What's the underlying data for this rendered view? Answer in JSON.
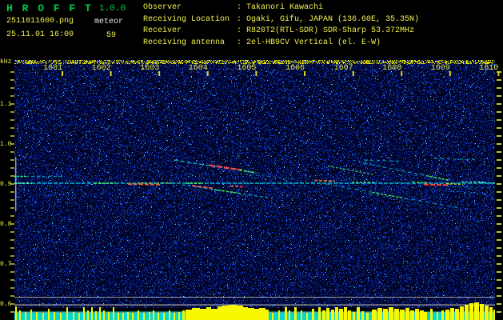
{
  "header": {
    "title": "H R O F F T",
    "version": "1.0.0",
    "filename": "2511011600.png",
    "mode": "meteor",
    "datetime": "25.11.01 16:00",
    "count": "59",
    "info": [
      {
        "label": "Observer",
        "value": "Takanori Kawachi"
      },
      {
        "label": "Receiving Location",
        "value": "Ogaki, Gifu, JAPAN (136.60E, 35.35N)"
      },
      {
        "label": "Receiver",
        "value": "R820T2(RTL-SDR) SDR-Sharp 53.372MHz"
      },
      {
        "label": "Receiving antenna",
        "value": "2el-HB9CV Vertical (el. E-W)"
      }
    ]
  },
  "spectrogram": {
    "unit_label": "kHz",
    "freq_labels": [
      "1.1",
      "1.0",
      "0.9",
      "0.8",
      "0.7",
      "0.6"
    ],
    "time_labels": [
      "1601",
      "1602",
      "1603",
      "1604",
      "1605",
      "1606",
      "1607",
      "1608",
      "1609",
      "1610"
    ],
    "colors": {
      "title_green": "#00cc44",
      "text_yellow": "#f0f050",
      "text_white": "#e8e8e8",
      "tick_yellow": "#d8d830",
      "trail_cyan": "#00c8d8",
      "hot_red": "#ff4444",
      "hot_green": "#55ee55",
      "signal_bar": "#f8f800",
      "signal_band": "#00d8d8",
      "grid_gray": "#a0a0a0"
    },
    "noise": {
      "seed": 987654321
    },
    "gray_lines": [
      [
        18,
        371.0,
        601,
        1.0,
        "#999999"
      ],
      [
        18,
        380.5,
        601,
        1.2,
        "#aaaaaa"
      ]
    ],
    "gray_line_low": [
      18,
      390.0,
      601,
      1.0,
      "#888888"
    ],
    "vertical_line": [
      19,
      196,
      1.4,
      68,
      "#cccccc"
    ],
    "trails": [
      [
        18,
        229,
        619,
        229,
        "#00c8d8",
        1.5,
        "5 2",
        0.9
      ],
      [
        18,
        220.5,
        80,
        220.5,
        "#00b0c0",
        1.3,
        "4 3",
        0.8
      ],
      [
        18,
        220.5,
        34,
        220.5,
        "#55ee55",
        1.8,
        "2 2",
        0.9
      ],
      [
        18,
        229,
        40,
        229,
        "#66ffcc",
        1.8,
        "3 2",
        0.85
      ],
      [
        118,
        229,
        144,
        229,
        "#55ee55",
        1.8,
        "3 2",
        0.9
      ],
      [
        160,
        230,
        202,
        230.8,
        "#ff6633",
        2.0,
        "5 2",
        0.9
      ],
      [
        172,
        228.5,
        214,
        229,
        "#aaee44",
        1.3,
        "2 3",
        0.85
      ],
      [
        233,
        229,
        254,
        229,
        "#55ee55",
        1.8,
        "3 2",
        0.9
      ],
      [
        218,
        200,
        322,
        216.5,
        "#00c8d8",
        1.4,
        "5 3",
        0.85
      ],
      [
        262,
        206.5,
        302,
        212.5,
        "#ff4444",
        2.4,
        "7 2",
        0.95
      ],
      [
        300,
        212.5,
        320,
        216,
        "#55ee55",
        1.8,
        "3 2",
        0.9
      ],
      [
        228,
        231,
        335,
        247,
        "#00c0d0",
        1.3,
        "4 3",
        0.8
      ],
      [
        240,
        232,
        268,
        235.5,
        "#ff5544",
        2.0,
        "5 2",
        0.9
      ],
      [
        268,
        237,
        302,
        242,
        "#55ee55",
        1.6,
        "3 2",
        0.85
      ],
      [
        288,
        232.5,
        306,
        233.5,
        "#ff5544",
        1.8,
        "4 2",
        0.85
      ],
      [
        300,
        217,
        368,
        223.5,
        "#00a8b8",
        1.1,
        "3 4",
        0.6
      ],
      [
        350,
        194.5,
        398,
        196,
        "#0098a8",
        1.0,
        "2 5",
        0.5
      ],
      [
        393,
        225.5,
        419,
        226.5,
        "#ff7733",
        1.8,
        "4 2",
        0.85
      ],
      [
        410,
        207.5,
        466,
        218,
        "#44dd77",
        1.4,
        "3 2",
        0.8
      ],
      [
        455,
        200,
        500,
        201.5,
        "#00c8d8",
        1.2,
        "4 4",
        0.75
      ],
      [
        543,
        198,
        594,
        199.5,
        "#00c8d8",
        1.2,
        "4 4",
        0.75
      ],
      [
        455,
        204,
        565,
        226,
        "#00b8c8",
        1.2,
        "5 3",
        0.7
      ],
      [
        533,
        219.5,
        560,
        225,
        "#55ee55",
        1.6,
        "3 2",
        0.85
      ],
      [
        516,
        227.5,
        534,
        228.5,
        "#55ee55",
        1.6,
        "3 2",
        0.85
      ],
      [
        530,
        230.5,
        562,
        231.5,
        "#ff4433",
        2.2,
        "6 2",
        0.95
      ],
      [
        558,
        229.5,
        579,
        230.5,
        "#ccee44",
        1.5,
        "3 2",
        0.85
      ],
      [
        577,
        227,
        605,
        227.8,
        "#55ffcc",
        1.4,
        "3 2",
        0.8
      ],
      [
        408,
        230,
        575,
        260,
        "#00b0c0",
        1.2,
        "5 4",
        0.75
      ],
      [
        466,
        240.5,
        504,
        247.5,
        "#55ee55",
        1.5,
        "3 2",
        0.8
      ],
      [
        455,
        241,
        553,
        261,
        "#0098b0",
        1.0,
        "3 5",
        0.6
      ],
      [
        540,
        236,
        616,
        244,
        "#00a8b8",
        1.0,
        "3 5",
        0.6
      ],
      [
        598,
        228,
        619,
        229,
        "#44e0e0",
        1.5,
        "4 2",
        0.85
      ],
      [
        560,
        233.5,
        619,
        234.5,
        "#00a8c0",
        1.0,
        "3 4",
        0.6
      ],
      [
        440,
        228,
        468,
        228,
        "#55ee77",
        1.6,
        "3 2",
        0.85
      ]
    ],
    "bars": [
      [
        19,
        2,
        17
      ],
      [
        24,
        2,
        12
      ],
      [
        31,
        2,
        10
      ],
      [
        38,
        2,
        13
      ],
      [
        45,
        2,
        10
      ],
      [
        53,
        2,
        9
      ],
      [
        60,
        2,
        14
      ],
      [
        67,
        2,
        10
      ],
      [
        75,
        2,
        9
      ],
      [
        83,
        2,
        16
      ],
      [
        91,
        2,
        10
      ],
      [
        98,
        2,
        9
      ],
      [
        104,
        2,
        16
      ],
      [
        109,
        2,
        12
      ],
      [
        114,
        2,
        16
      ],
      [
        119,
        2,
        11
      ],
      [
        124,
        2,
        16
      ],
      [
        129,
        2,
        12
      ],
      [
        135,
        2,
        10
      ],
      [
        141,
        2,
        16
      ],
      [
        147,
        2,
        9
      ],
      [
        153,
        2,
        9
      ],
      [
        159,
        2,
        10
      ],
      [
        165,
        2,
        9
      ],
      [
        172,
        2,
        12
      ],
      [
        179,
        2,
        9
      ],
      [
        186,
        2,
        10
      ],
      [
        191,
        2,
        12
      ],
      [
        197,
        2,
        9
      ],
      [
        204,
        2,
        9
      ],
      [
        211,
        2,
        12
      ],
      [
        217,
        2,
        9
      ],
      [
        223,
        2,
        10
      ],
      [
        228,
        3,
        12
      ],
      [
        232,
        8,
        13
      ],
      [
        240,
        10,
        15
      ],
      [
        250,
        8,
        14
      ],
      [
        258,
        6,
        16
      ],
      [
        264,
        8,
        14
      ],
      [
        272,
        6,
        17
      ],
      [
        278,
        8,
        18
      ],
      [
        286,
        10,
        19
      ],
      [
        296,
        8,
        18
      ],
      [
        304,
        6,
        16
      ],
      [
        310,
        8,
        15
      ],
      [
        318,
        6,
        14
      ],
      [
        324,
        8,
        15
      ],
      [
        332,
        4,
        13
      ],
      [
        340,
        2,
        9
      ],
      [
        348,
        2,
        12
      ],
      [
        356,
        3,
        16
      ],
      [
        361,
        2,
        12
      ],
      [
        368,
        3,
        16
      ],
      [
        376,
        2,
        12
      ],
      [
        383,
        2,
        9
      ],
      [
        390,
        3,
        14
      ],
      [
        398,
        3,
        16
      ],
      [
        403,
        4,
        12
      ],
      [
        408,
        4,
        15
      ],
      [
        414,
        4,
        13
      ],
      [
        419,
        4,
        16
      ],
      [
        424,
        5,
        14
      ],
      [
        430,
        4,
        16
      ],
      [
        435,
        4,
        12
      ],
      [
        441,
        3,
        10
      ],
      [
        446,
        4,
        16
      ],
      [
        452,
        3,
        11
      ],
      [
        458,
        3,
        9
      ],
      [
        465,
        6,
        13
      ],
      [
        472,
        6,
        15
      ],
      [
        479,
        6,
        14
      ],
      [
        486,
        6,
        16
      ],
      [
        493,
        6,
        14
      ],
      [
        500,
        6,
        13
      ],
      [
        507,
        5,
        15
      ],
      [
        513,
        5,
        12
      ],
      [
        519,
        5,
        14
      ],
      [
        525,
        5,
        12
      ],
      [
        530,
        4,
        10
      ],
      [
        538,
        3,
        14
      ],
      [
        546,
        2,
        10
      ],
      [
        552,
        3,
        12
      ],
      [
        557,
        5,
        13
      ],
      [
        563,
        5,
        15
      ],
      [
        569,
        5,
        14
      ],
      [
        575,
        5,
        17
      ],
      [
        581,
        5,
        19
      ],
      [
        587,
        5,
        21
      ],
      [
        593,
        6,
        22
      ],
      [
        600,
        5,
        20
      ],
      [
        606,
        5,
        18
      ],
      [
        612,
        4,
        16
      ],
      [
        617,
        2,
        13
      ]
    ]
  }
}
